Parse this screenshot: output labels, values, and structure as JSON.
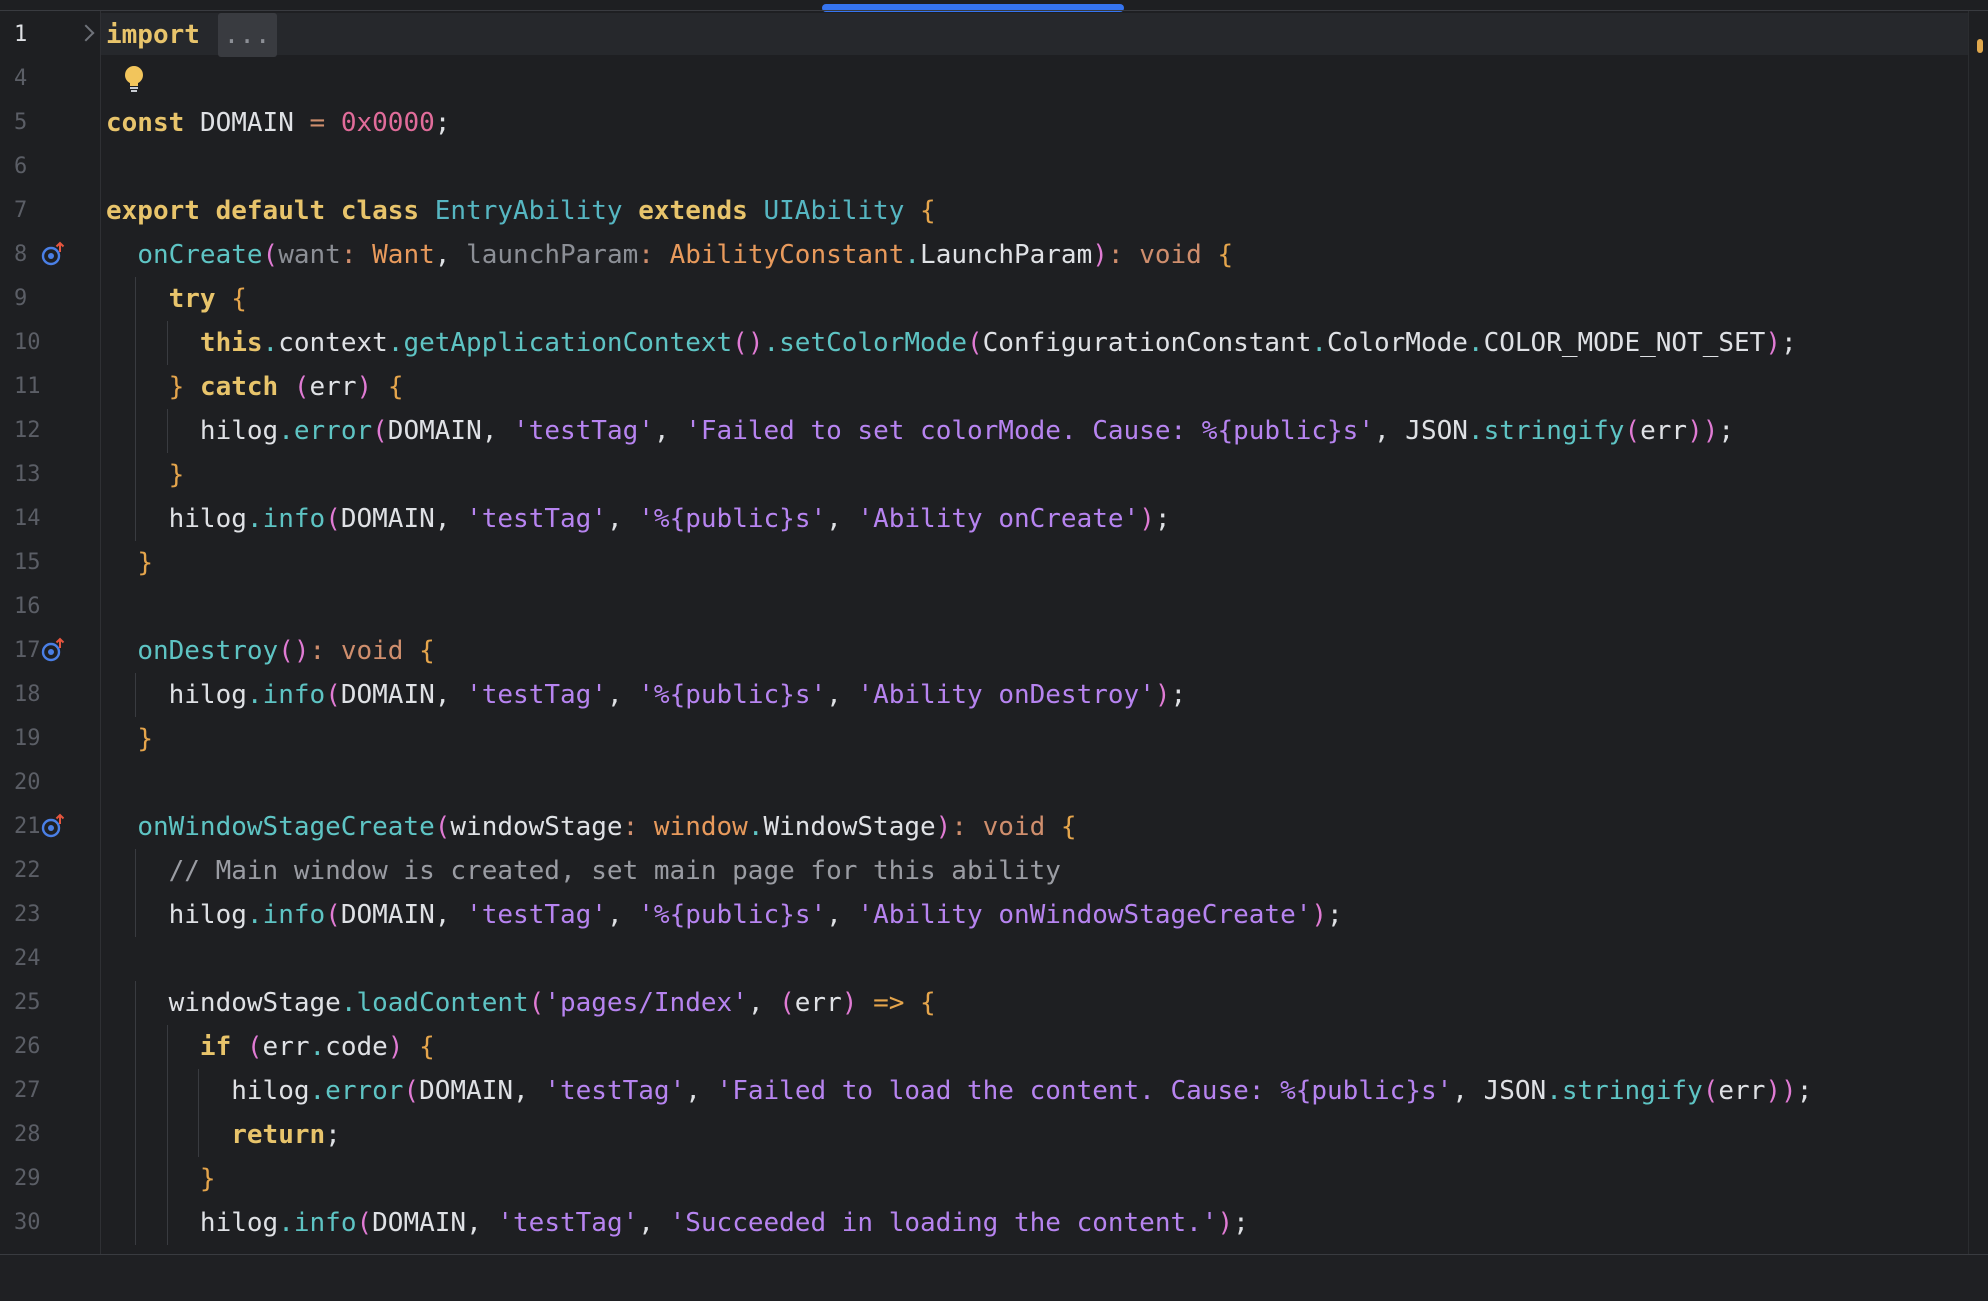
{
  "editor": {
    "folded_import": {
      "keyword": "import",
      "ellipsis": "..."
    },
    "lines": [
      {
        "number": "1",
        "text": "import ..."
      },
      {
        "number": "4",
        "text": ""
      },
      {
        "number": "5",
        "text": "const DOMAIN = 0x0000;"
      },
      {
        "number": "6",
        "text": ""
      },
      {
        "number": "7",
        "text": "export default class EntryAbility extends UIAbility {"
      },
      {
        "number": "8",
        "text": "  onCreate(want: Want, launchParam: AbilityConstant.LaunchParam): void {"
      },
      {
        "number": "9",
        "text": "    try {"
      },
      {
        "number": "10",
        "text": "      this.context.getApplicationContext().setColorMode(ConfigurationConstant.ColorMode.COLOR_MODE_NOT_SET);"
      },
      {
        "number": "11",
        "text": "    } catch (err) {"
      },
      {
        "number": "12",
        "text": "      hilog.error(DOMAIN, 'testTag', 'Failed to set colorMode. Cause: %{public}s', JSON.stringify(err));"
      },
      {
        "number": "13",
        "text": "    }"
      },
      {
        "number": "14",
        "text": "    hilog.info(DOMAIN, 'testTag', '%{public}s', 'Ability onCreate');"
      },
      {
        "number": "15",
        "text": "  }"
      },
      {
        "number": "16",
        "text": ""
      },
      {
        "number": "17",
        "text": "  onDestroy(): void {"
      },
      {
        "number": "18",
        "text": "    hilog.info(DOMAIN, 'testTag', '%{public}s', 'Ability onDestroy');"
      },
      {
        "number": "19",
        "text": "  }"
      },
      {
        "number": "20",
        "text": ""
      },
      {
        "number": "21",
        "text": "  onWindowStageCreate(windowStage: window.WindowStage): void {"
      },
      {
        "number": "22",
        "text": "    // Main window is created, set main page for this ability"
      },
      {
        "number": "23",
        "text": "    hilog.info(DOMAIN, 'testTag', '%{public}s', 'Ability onWindowStageCreate');"
      },
      {
        "number": "24",
        "text": ""
      },
      {
        "number": "25",
        "text": "    windowStage.loadContent('pages/Index', (err) => {"
      },
      {
        "number": "26",
        "text": "      if (err.code) {"
      },
      {
        "number": "27",
        "text": "        hilog.error(DOMAIN, 'testTag', 'Failed to load the content. Cause: %{public}s', JSON.stringify(err));"
      },
      {
        "number": "28",
        "text": "        return;"
      },
      {
        "number": "29",
        "text": "      }"
      },
      {
        "number": "30",
        "text": "      hilog.info(DOMAIN, 'testTag', 'Succeeded in loading the content.');"
      }
    ],
    "gutter_icons": {
      "line_8": "override-method-icon",
      "line_17": "override-method-icon",
      "line_21": "override-method-icon",
      "line_4": "lightbulb-icon"
    },
    "colors": {
      "background": "#1e1f22",
      "keyword": "#e8c46b",
      "string": "#b784f0",
      "method": "#5ec4c4",
      "type": "#e89a5c",
      "number": "#e06c9a",
      "comment": "#9a9ca3",
      "scroll_indicator": "#3574f0"
    }
  }
}
